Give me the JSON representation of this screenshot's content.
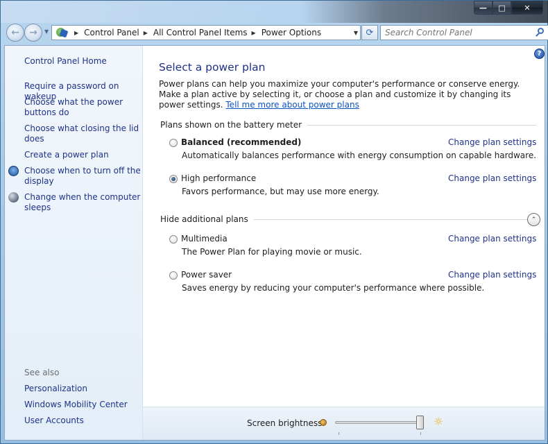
{
  "window": {
    "caption_buttons": {
      "minimize": "—",
      "maximize": "□",
      "close": "✕"
    }
  },
  "navbar": {
    "back_glyph": "←",
    "forward_glyph": "→",
    "breadcrumbs": [
      "Control Panel",
      "All Control Panel Items",
      "Power Options"
    ],
    "refresh_glyph": "⟳",
    "search_placeholder": "Search Control Panel"
  },
  "sidebar": {
    "home": "Control Panel Home",
    "tasks": [
      "Require a password on wakeup",
      "Choose what the power buttons do",
      "Choose what closing the lid does",
      "Create a power plan",
      "Choose when to turn off the display",
      "Change when the computer sleeps"
    ],
    "see_also_heading": "See also",
    "see_also": [
      "Personalization",
      "Windows Mobility Center",
      "User Accounts"
    ]
  },
  "main": {
    "help_glyph": "?",
    "title": "Select a power plan",
    "intro_text": "Power plans can help you maximize your computer's performance or conserve energy. Make a plan active by selecting it, or choose a plan and customize it by changing its power settings. ",
    "intro_link": "Tell me more about power plans",
    "battery_group_label": "Plans shown on the battery meter",
    "additional_group_label": "Hide additional plans",
    "chevron_glyph": "⌃",
    "change_label": "Change plan settings",
    "plans": [
      {
        "name": "Balanced (recommended)",
        "description": "Automatically balances performance with energy consumption on capable hardware.",
        "selected": false
      },
      {
        "name": "High performance",
        "description": "Favors performance, but may use more energy.",
        "selected": true
      },
      {
        "name": "Multimedia",
        "description": "The Power Plan for playing movie or music.",
        "selected": false
      },
      {
        "name": "Power saver",
        "description": "Saves energy by reducing your computer's performance where possible.",
        "selected": false
      }
    ]
  },
  "footer": {
    "brightness_label": "Screen brightness:",
    "brightness_level": 1.0,
    "sun_glyph": "☼"
  },
  "colors": {
    "link": "#1e3287",
    "accent_link": "#0b52c4",
    "sidebar_bg": "#e8f0f8"
  }
}
